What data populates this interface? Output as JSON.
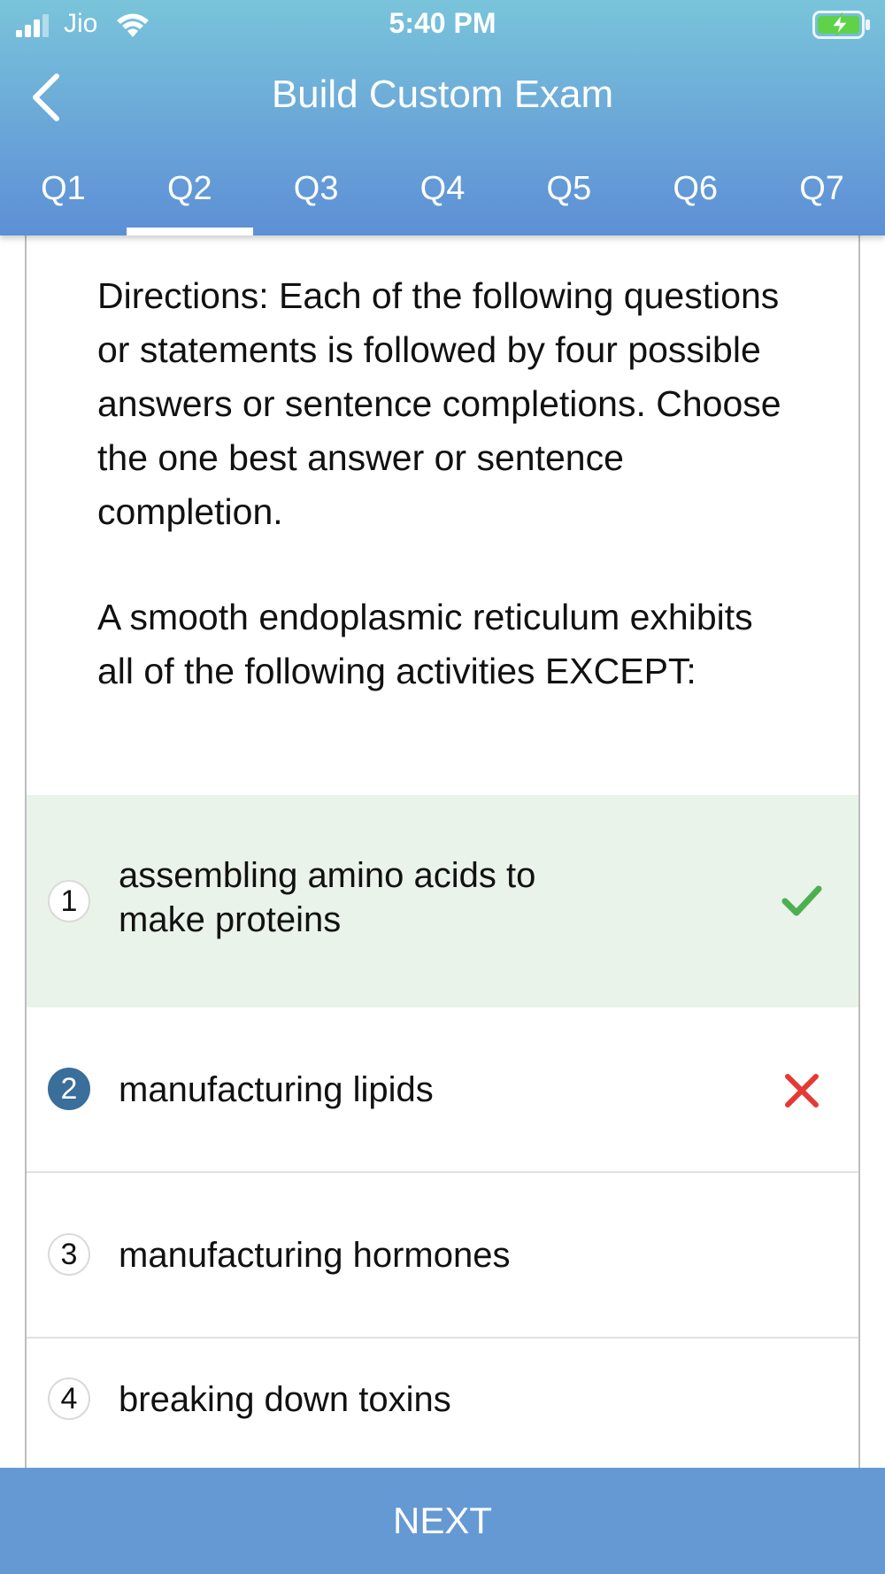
{
  "status_bar": {
    "carrier": "Jio",
    "time": "5:40 PM",
    "icons": [
      "signal-icon",
      "wifi-icon",
      "battery-charging-icon"
    ]
  },
  "nav": {
    "title": "Build Custom Exam",
    "back_icon": "chevron-left-icon"
  },
  "tabs": [
    {
      "label": "Q1",
      "active": false
    },
    {
      "label": "Q2",
      "active": true
    },
    {
      "label": "Q3",
      "active": false
    },
    {
      "label": "Q4",
      "active": false
    },
    {
      "label": "Q5",
      "active": false
    },
    {
      "label": "Q6",
      "active": false
    },
    {
      "label": "Q7",
      "active": false
    }
  ],
  "question": {
    "directions": "Directions: Each of the following questions or statements is followed by four possible answers or sentence completions. Choose the one best answer or sentence completion.",
    "stem": "A smooth endoplasmic reticulum exhibits all of the following activities EXCEPT:"
  },
  "answers": [
    {
      "number": "1",
      "text_line1": "assembling amino acids to",
      "text_line2": "make proteins",
      "state": "correct",
      "mark_icon": "checkmark-icon",
      "mark_color": "#4caf50"
    },
    {
      "number": "2",
      "text": "manufacturing lipids",
      "state": "selected-wrong",
      "mark_icon": "cross-icon",
      "mark_color": "#e53935"
    },
    {
      "number": "3",
      "text": "manufacturing hormones",
      "state": "none"
    },
    {
      "number": "4",
      "text": "breaking down toxins",
      "state": "none"
    }
  ],
  "footer": {
    "next_label": "NEXT"
  },
  "colors": {
    "header_top": "#79c4da",
    "header_bottom": "#5d8fd6",
    "correct_bg": "#e9f3e9",
    "selected_badge": "#3a6e9b",
    "next_bar": "#6599d4"
  }
}
